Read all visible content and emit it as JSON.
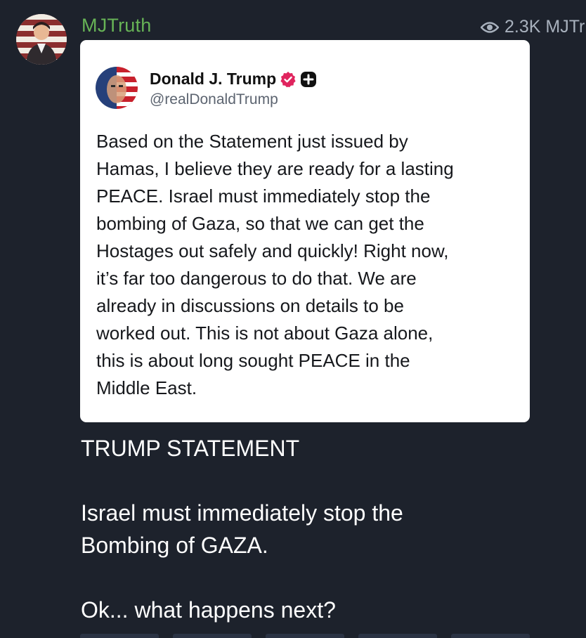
{
  "channel": {
    "name": "MJTruth",
    "views": "2.3K MJTru",
    "name_color": "#67b356"
  },
  "embedded_post": {
    "author_name": "Donald J. Trump",
    "author_handle": "@realDonaldTrump",
    "verified_icon": "verified-badge-icon",
    "plus_icon": "plus-badge-icon",
    "body": "Based on the Statement just issued by\nHamas, I believe they are ready for a lasting\nPEACE. Israel must immediately stop the\nbombing of Gaza, so that we can get the\nHostages out safely and quickly! Right now,\nit’s far too dangerous to do that. We are\nalready in discussions on details to be\nworked out. This is not about Gaza alone,\nthis is about long sought PEACE in the\nMiddle East."
  },
  "caption": {
    "line1": "TRUMP STATEMENT",
    "line2": "Israel must immediately stop the",
    "line3": "Bombing of GAZA.",
    "line4": "Ok... what happens next?"
  },
  "colors": {
    "background": "#1d222c",
    "accent_green": "#67b356",
    "verified_pink": "#e0245e"
  }
}
